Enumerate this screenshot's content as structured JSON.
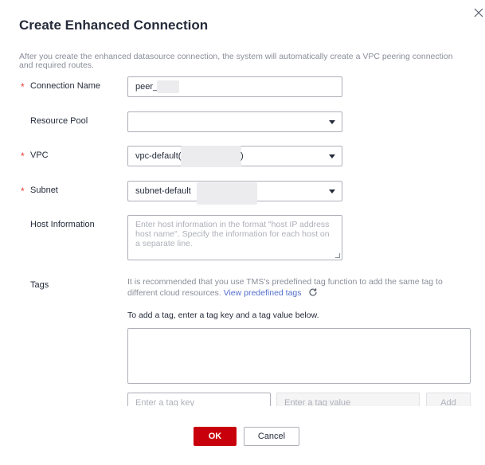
{
  "dialog": {
    "title": "Create Enhanced Connection",
    "intro": "After you create the enhanced datasource connection, the system will automatically create a VPC peering connection and required routes."
  },
  "form": {
    "required_mark": "*",
    "connection_name": {
      "label": "Connection Name",
      "value": "peer_"
    },
    "resource_pool": {
      "label": "Resource Pool",
      "value": ""
    },
    "vpc": {
      "label": "VPC",
      "value": "vpc-default(",
      "suffix": ")"
    },
    "subnet": {
      "label": "Subnet",
      "value": "subnet-default"
    },
    "host_information": {
      "label": "Host Information",
      "placeholder": "Enter host information in the format \"host IP address host name\". Specify the information for each host on a separate line."
    },
    "tags": {
      "label": "Tags",
      "tip": "It is recommended that you use TMS's predefined tag function to add the same tag to different cloud resources.",
      "link": "View predefined tags",
      "hint": "To add a tag, enter a tag key and a tag value below.",
      "key_placeholder": "Enter a tag key",
      "value_placeholder": "Enter a tag value",
      "add_label": "Add"
    }
  },
  "footer": {
    "ok_label": "OK",
    "cancel_label": "Cancel"
  },
  "icons": {
    "close": "close-icon",
    "refresh": "refresh-icon",
    "dropdown": "chevron-down-icon"
  },
  "colors": {
    "primary": "#c7000b",
    "required": "#e53935",
    "link": "#526ecc"
  }
}
